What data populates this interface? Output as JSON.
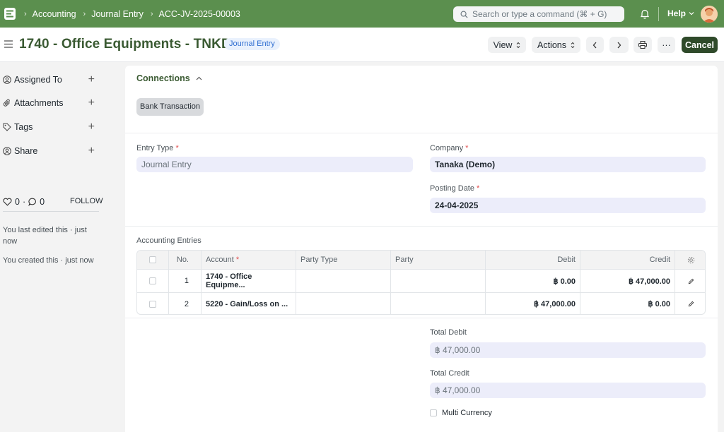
{
  "navbar": {
    "breadcrumbs": [
      "Accounting",
      "Journal Entry",
      "ACC-JV-2025-00003"
    ],
    "search_placeholder": "Search or type a command (⌘ + G)",
    "help_label": "Help",
    "bg_color": "#5b8f4e"
  },
  "header": {
    "title": "1740 - Office Equipments - TNKD",
    "badge": "Journal Entry",
    "view_label": "View",
    "actions_label": "Actions",
    "more_label": "···",
    "cancel_label": "Cancel"
  },
  "sidebar": {
    "items": [
      {
        "label": "Assigned To",
        "icon": "assigned-icon"
      },
      {
        "label": "Attachments",
        "icon": "paperclip-icon"
      },
      {
        "label": "Tags",
        "icon": "tag-icon"
      },
      {
        "label": "Share",
        "icon": "share-icon"
      }
    ],
    "likes": "0",
    "comments": "0",
    "dot": "·",
    "follow_label": "FOLLOW",
    "last_edited": "You last edited this · just now",
    "created": "You created this · just now"
  },
  "connections": {
    "title": "Connections",
    "chip": "Bank Transaction"
  },
  "form": {
    "entry_type_label": "Entry Type",
    "entry_type_value": "Journal Entry",
    "company_label": "Company",
    "company_value": "Tanaka (Demo)",
    "posting_date_label": "Posting Date",
    "posting_date_value": "24-04-2025",
    "required_mark": "*"
  },
  "accounting_entries": {
    "label": "Accounting Entries",
    "columns": [
      "No.",
      "Account",
      "Party Type",
      "Party",
      "Debit",
      "Credit"
    ],
    "rows": [
      {
        "no": "1",
        "account": "1740 - Office Equipme...",
        "party_type": "",
        "party": "",
        "debit": "฿ 0.00",
        "credit": "฿ 47,000.00"
      },
      {
        "no": "2",
        "account": "5220 - Gain/Loss on ...",
        "party_type": "",
        "party": "",
        "debit": "฿ 47,000.00",
        "credit": "฿ 0.00"
      }
    ]
  },
  "totals": {
    "total_debit_label": "Total Debit",
    "total_debit_value": "฿ 47,000.00",
    "total_credit_label": "Total Credit",
    "total_credit_value": "฿ 47,000.00",
    "multi_currency_label": "Multi Currency"
  }
}
